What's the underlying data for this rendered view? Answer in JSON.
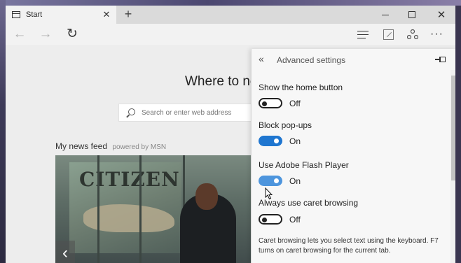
{
  "tab": {
    "title": "Start",
    "close": "✕"
  },
  "window_controls": {
    "new_tab": "+"
  },
  "nav": {
    "back": "←",
    "forward": "→",
    "refresh": "↻",
    "more": "···"
  },
  "page": {
    "headline": "Where to ne",
    "search_placeholder": "Search or enter web address",
    "feed_title": "My news feed",
    "feed_powered": "powered by MSN",
    "news_prev": "‹",
    "poster_text": "CITIZEN"
  },
  "settings": {
    "back": "«",
    "title": "Advanced settings",
    "items": [
      {
        "label": "Show the home button",
        "state": "Off"
      },
      {
        "label": "Block pop-ups",
        "state": "On"
      },
      {
        "label": "Use Adobe Flash Player",
        "state": "On"
      },
      {
        "label": "Always use caret browsing",
        "state": "Off"
      }
    ],
    "caret_description": "Caret browsing lets you select text using the keyboard. F7 turns on caret browsing for the current tab."
  },
  "colors": {
    "toggle_on": "#1f76d0",
    "toggle_hover": "#4d95dd",
    "panel_bg": "#f7f7f7"
  }
}
